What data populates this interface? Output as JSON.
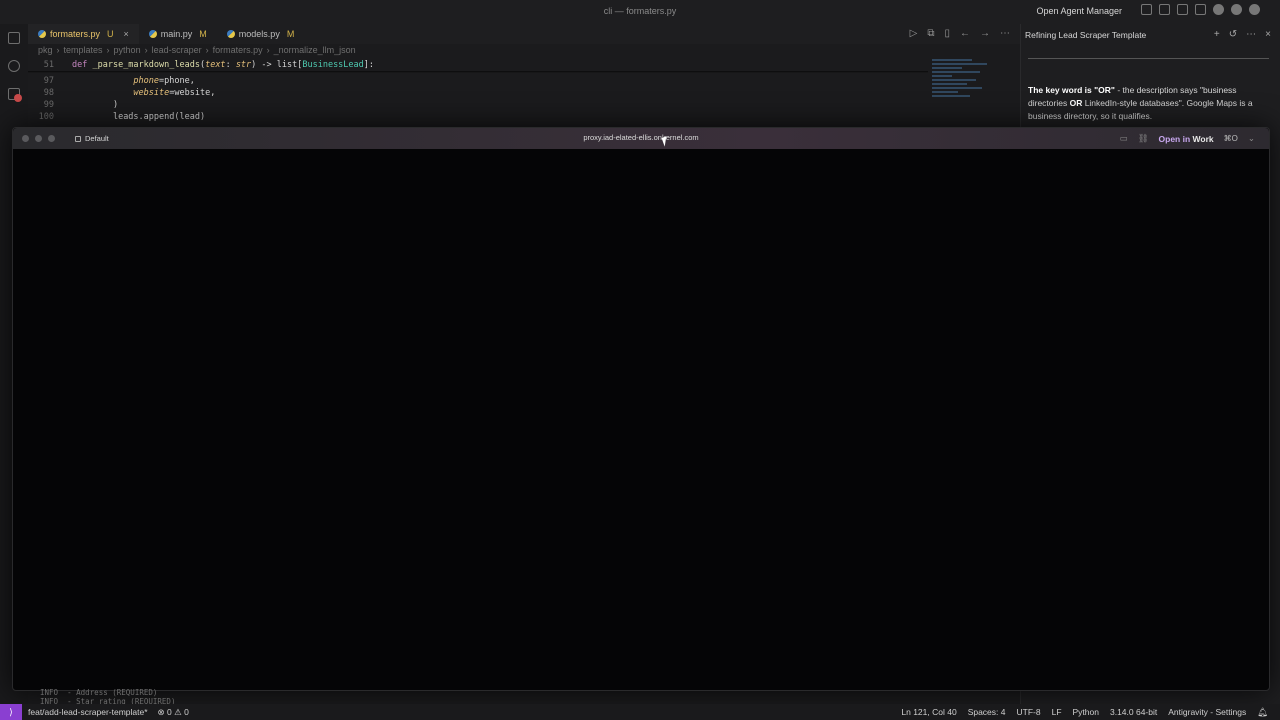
{
  "titlebar": {
    "center_title": "cli — formaters.py",
    "agent_manager": "Open Agent Manager"
  },
  "tabs": [
    {
      "label": "formaters.py",
      "badge": "U",
      "active": true
    },
    {
      "label": "main.py",
      "badge": "M"
    },
    {
      "label": "models.py",
      "badge": "M"
    }
  ],
  "breadcrumb": [
    "pkg",
    "templates",
    "python",
    "lead-scraper",
    "formaters.py",
    "_normalize_llm_json"
  ],
  "code": {
    "lines": [
      {
        "n": "51",
        "tokens": [
          [
            "kw",
            "def "
          ],
          [
            "fn",
            "_parse_markdown_leads"
          ],
          [
            "id",
            "("
          ],
          [
            "param",
            "text"
          ],
          [
            "id",
            ": "
          ],
          [
            "param",
            "str"
          ],
          [
            "id",
            ") -> "
          ],
          [
            "id",
            "list["
          ],
          [
            "ty",
            "BusinessLead"
          ],
          [
            "id",
            "]:"
          ]
        ],
        "indent": 0
      },
      {
        "n": "97",
        "tokens": [
          [
            "param",
            "phone"
          ],
          [
            "id",
            "=phone,"
          ]
        ],
        "indent": 12
      },
      {
        "n": "98",
        "tokens": [
          [
            "param",
            "website"
          ],
          [
            "id",
            "=website,"
          ]
        ],
        "indent": 12
      },
      {
        "n": "99",
        "tokens": [
          [
            "id",
            ")"
          ]
        ],
        "indent": 8
      },
      {
        "n": "100",
        "tokens": [
          [
            "id",
            "leads.append(lead)"
          ]
        ],
        "indent": 8
      }
    ]
  },
  "agent_panel": {
    "title": "Refining Lead Scraper Template",
    "message_bold_1": "The key word is \"OR\"",
    "message_1": " - the description says \"business directories ",
    "message_bold_2": "OR",
    "message_2": " LinkedIn-style databases\". Google Maps is a business directory, so it qualifies."
  },
  "browser": {
    "profile": "Default",
    "url": "proxy.iad-elated-ellis.onkernel.com",
    "open_in": "Open in",
    "open_target": "Work",
    "shortcut": "⌘O"
  },
  "terminal": {
    "lines": [
      "INFO  - Address (REQUIRED)",
      "INFO  - Star rating (REQUIRED)"
    ]
  },
  "status": {
    "branch": "feat/add-lead-scraper-template*",
    "problems": "⊗ 0 ⚠ 0",
    "cursor": "Ln 121, Col 40",
    "spaces": "Spaces: 4",
    "encoding": "UTF-8",
    "eol": "LF",
    "language": "Python",
    "interpreter": "3.14.0 64-bit",
    "app": "Antigravity - Settings"
  }
}
